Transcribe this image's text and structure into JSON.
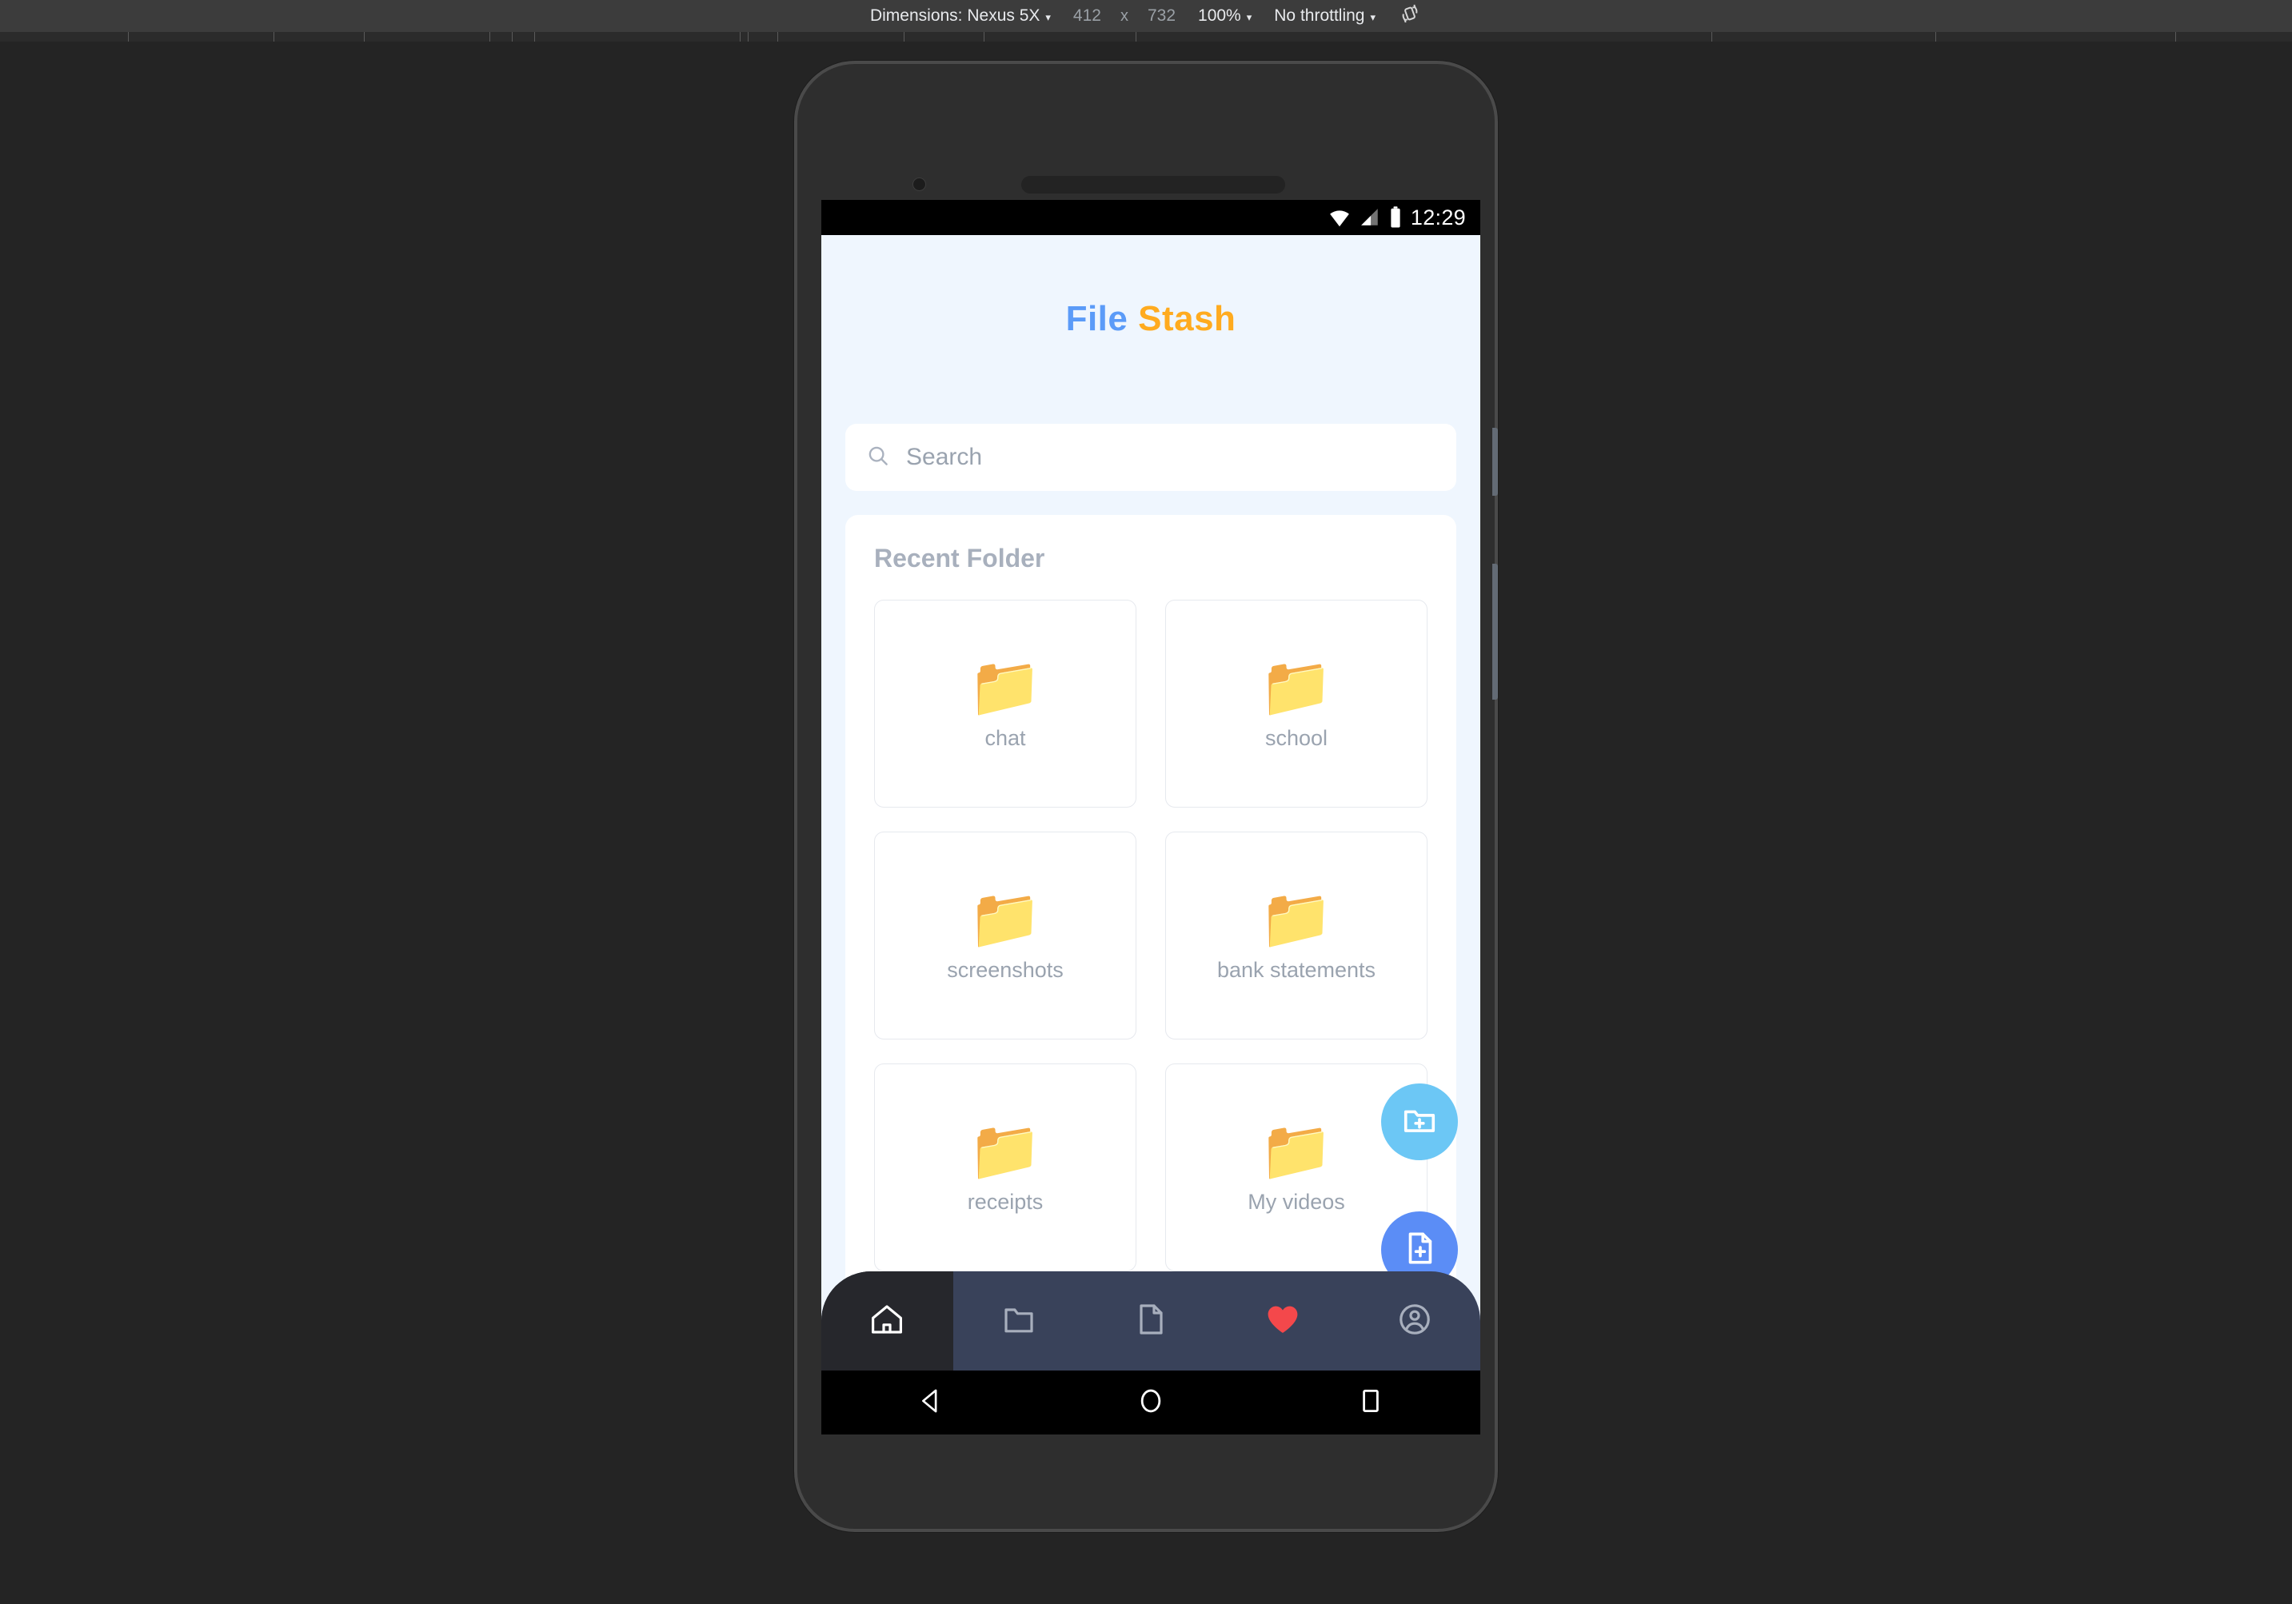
{
  "devtools": {
    "dimensions_label": "Dimensions: Nexus 5X",
    "width_value": "412",
    "times_symbol": "x",
    "height_value": "732",
    "zoom_value": "100%",
    "throttling_value": "No throttling",
    "rotate_icon": "rotate-icon"
  },
  "status_bar": {
    "wifi_icon": "wifi-icon",
    "signal_icon": "cell-signal-icon",
    "battery_icon": "battery-icon",
    "clock": "12:29"
  },
  "app": {
    "title_part_1": "File",
    "title_part_2": "Stash",
    "title_color_1": "#5b9bf8",
    "title_color_2": "#ffab1f",
    "background_color": "#eff6fe"
  },
  "search": {
    "placeholder": "Search",
    "value": "",
    "icon": "search-icon"
  },
  "recent": {
    "heading": "Recent Folder",
    "folder_icon": "folder-emoji",
    "items": [
      {
        "label": "chat"
      },
      {
        "label": "school"
      },
      {
        "label": "screenshots"
      },
      {
        "label": "bank statements"
      },
      {
        "label": "receipts"
      },
      {
        "label": "My videos"
      }
    ]
  },
  "fabs": [
    {
      "name": "new-folder",
      "icon": "folder-plus-icon",
      "color": "#6cc7f5"
    },
    {
      "name": "new-file",
      "icon": "file-plus-icon",
      "color": "#5b8df6"
    }
  ],
  "bottom_nav": {
    "background_color": "#39425a",
    "active_color": "#26272c",
    "heart_color": "#f4484b",
    "items": [
      {
        "name": "home",
        "icon": "home-icon",
        "active": true
      },
      {
        "name": "folders",
        "icon": "folder-outline-icon",
        "active": false
      },
      {
        "name": "files",
        "icon": "file-outline-icon",
        "active": false
      },
      {
        "name": "favorites",
        "icon": "heart-icon",
        "active": false
      },
      {
        "name": "account",
        "icon": "account-circle-icon",
        "active": false
      }
    ]
  },
  "system_nav": {
    "back_icon": "back-triangle-icon",
    "home_icon": "home-circle-icon",
    "recents_icon": "recents-square-icon"
  }
}
